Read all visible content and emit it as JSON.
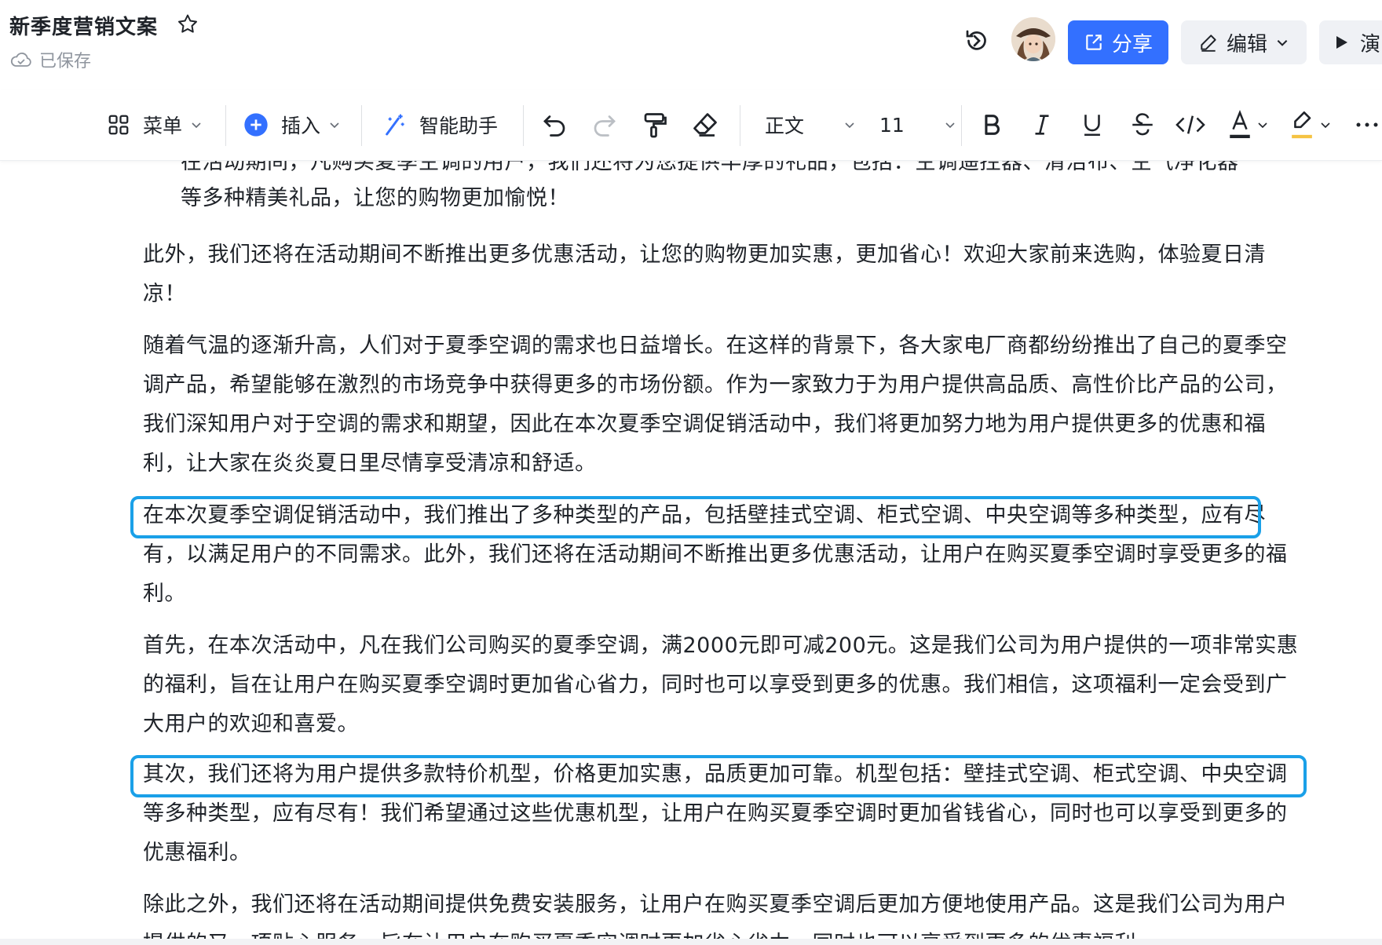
{
  "header": {
    "title": "新季度营销文案",
    "saved_status": "已保存",
    "share_label": "分享",
    "edit_label": "编辑",
    "present_label": "演"
  },
  "toolbar": {
    "menu_label": "菜单",
    "insert_label": "插入",
    "assistant_label": "智能助手",
    "style_value": "正文",
    "font_size_value": "11",
    "colors": {
      "accent": "#3370ff",
      "text_color_underline": "#1f2329",
      "highlight_underline": "#f5c343"
    }
  },
  "document": {
    "partial_top_line": "在活动期间，凡购买夏季空调的用户，我们还将为您提供丰厚的礼品，包括：空调遥控器、清洁布、空气净化器",
    "list_tail": "等多种精美礼品，让您的购物更加愉悦！",
    "paragraphs": [
      "此外，我们还将在活动期间不断推出更多优惠活动，让您的购物更加实惠，更加省心！欢迎大家前来选购，体验夏日清凉！",
      "随着气温的逐渐升高，人们对于夏季空调的需求也日益增长。在这样的背景下，各大家电厂商都纷纷推出了自己的夏季空调产品，希望能够在激烈的市场竞争中获得更多的市场份额。作为一家致力于为用户提供高品质、高性价比产品的公司，我们深知用户对于空调的需求和期望，因此在本次夏季空调促销活动中，我们将更加努力地为用户提供更多的优惠和福利，让大家在炎炎夏日里尽情享受清凉和舒适。",
      "在本次夏季空调促销活动中，我们推出了多种类型的产品，包括壁挂式空调、柜式空调、中央空调等多种类型，应有尽有，以满足用户的不同需求。此外，我们还将在活动期间不断推出更多优惠活动，让用户在购买夏季空调时享受更多的福利。",
      "首先，在本次活动中，凡在我们公司购买的夏季空调，满2000元即可减200元。这是我们公司为用户提供的一项非常实惠的福利，旨在让用户在购买夏季空调时更加省心省力，同时也可以享受到更多的优惠。我们相信，这项福利一定会受到广大用户的欢迎和喜爱。",
      "其次，我们还将为用户提供多款特价机型，价格更加实惠，品质更加可靠。机型包括：壁挂式空调、柜式空调、中央空调等多种类型，应有尽有！我们希望通过这些优惠机型，让用户在购买夏季空调时更加省钱省心，同时也可以享受到更多的优惠福利。",
      "除此之外，我们还将在活动期间提供免费安装服务，让用户在购买夏季空调后更加方便地使用产品。这是我们公司为用户提供的又一项贴心服务，旨在让用户在购买夏季空调时更加省心省力，同时也可以享受到更多的优惠福利。"
    ],
    "highlight_color": "#1aa0e8"
  }
}
